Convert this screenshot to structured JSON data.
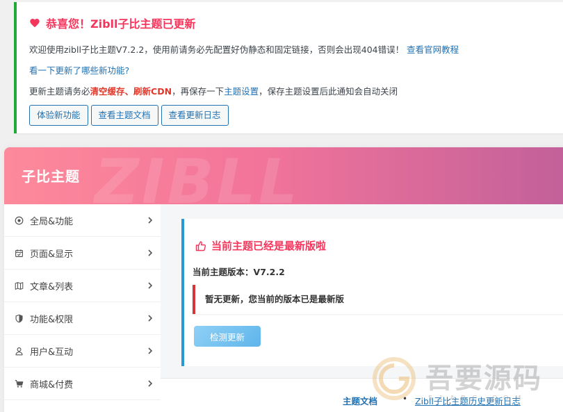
{
  "notice": {
    "title": "恭喜您！Zibll子比主题已更新",
    "line1_text": "欢迎使用zibll子比主题V7.2.2，使用前请务必先配置好伪静态和固定链接，否则会出现404错误！",
    "line1_link": "查看官网教程",
    "whats_new_link": "看一下更新了哪些新功能?",
    "line3_prefix": "更新主题请务必",
    "line3_red1": "清空缓存",
    "line3_sep": "、",
    "line3_red2": "刷新CDN",
    "line3_mid": "，再保存一下",
    "line3_link": "主题设置",
    "line3_suffix": "，保存主题设置后此通知会自动关闭",
    "buttons": [
      "体验新功能",
      "查看主题文档",
      "查看更新日志"
    ]
  },
  "hero": {
    "brand": "子比主题",
    "watermark": "ZIBLL"
  },
  "sidebar": {
    "items": [
      {
        "label": "全局&功能",
        "icon": "dot-circle-icon"
      },
      {
        "label": "页面&显示",
        "icon": "calendar-icon"
      },
      {
        "label": "文章&列表",
        "icon": "map-icon"
      },
      {
        "label": "功能&权限",
        "icon": "shield-icon"
      },
      {
        "label": "用户&互动",
        "icon": "user-icon"
      },
      {
        "label": "商城&付费",
        "icon": "cart-icon"
      }
    ]
  },
  "update": {
    "title": "当前主题已经是最新版啦",
    "version_label": "当前主题版本：",
    "version": "V7.2.2",
    "alert": "暂无更新，您当前的版本已是最新版",
    "check_button": "检测更新"
  },
  "footer": {
    "doc_link": "主题文档",
    "bullet": "•",
    "history_link": "Zibll子比主题历史更新日志"
  },
  "watermark": {
    "text": "吾要源码",
    "sub": "5 1 A B C . C O M"
  },
  "colors": {
    "accent_red": "#f5365c",
    "link_blue": "#2271b1",
    "success_green": "#1eaa35",
    "info_blue": "#2b98d6"
  }
}
